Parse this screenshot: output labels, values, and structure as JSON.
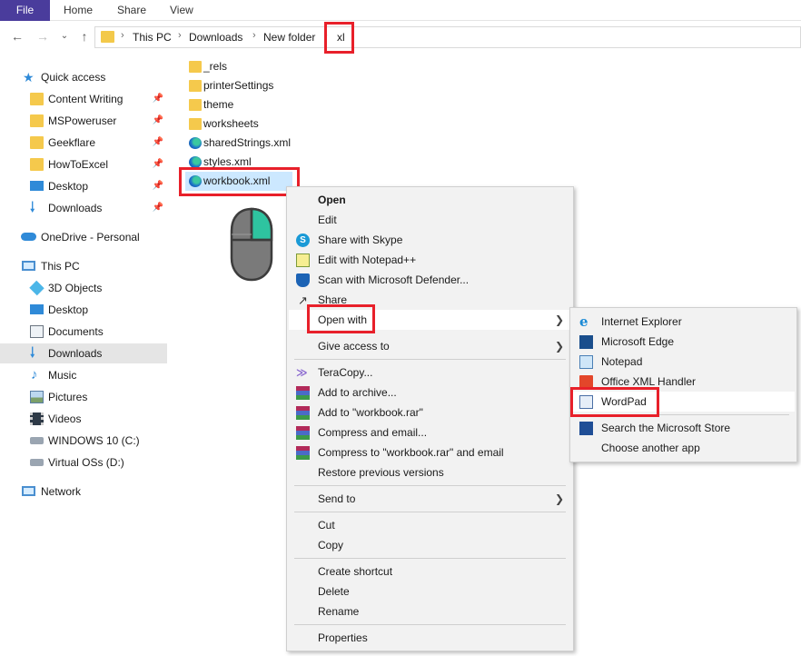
{
  "ribbon": {
    "tabs": [
      "File",
      "Home",
      "Share",
      "View"
    ]
  },
  "navbar": {
    "breadcrumb": [
      "This PC",
      "Downloads",
      "New folder",
      "xl"
    ]
  },
  "sidebar": {
    "quick_access": "Quick access",
    "pinned": [
      "Content Writing",
      "MSPoweruser",
      "Geekflare",
      "HowToExcel",
      "Desktop",
      "Downloads"
    ],
    "onedrive": "OneDrive - Personal",
    "this_pc": "This PC",
    "pc_items": [
      "3D Objects",
      "Desktop",
      "Documents",
      "Downloads",
      "Music",
      "Pictures",
      "Videos",
      "WINDOWS 10 (C:)",
      "Virtual OSs (D:)"
    ],
    "network": "Network",
    "selected": "Downloads"
  },
  "files": [
    {
      "name": "_rels",
      "type": "folder"
    },
    {
      "name": "printerSettings",
      "type": "folder"
    },
    {
      "name": "theme",
      "type": "folder"
    },
    {
      "name": "worksheets",
      "type": "folder"
    },
    {
      "name": "sharedStrings.xml",
      "type": "xml"
    },
    {
      "name": "styles.xml",
      "type": "xml"
    },
    {
      "name": "workbook.xml",
      "type": "xml"
    }
  ],
  "context_menu": {
    "items": [
      {
        "label": "Open",
        "icon": "none"
      },
      {
        "label": "Edit",
        "icon": "none"
      },
      {
        "label": "Share with Skype",
        "icon": "skype-icon"
      },
      {
        "label": "Edit with Notepad++",
        "icon": "notepad-plus-plus-icon"
      },
      {
        "label": "Scan with Microsoft Defender...",
        "icon": "defender-icon"
      },
      {
        "label": "Share",
        "icon": "share-icon"
      },
      {
        "label": "Open with",
        "icon": "none"
      },
      {
        "label": "Give access to",
        "icon": "none"
      },
      {
        "label": "TeraCopy...",
        "icon": "teracopy-icon"
      },
      {
        "label": "Add to archive...",
        "icon": "winrar-icon"
      },
      {
        "label": "Add to \"workbook.rar\"",
        "icon": "winrar-icon"
      },
      {
        "label": "Compress and email...",
        "icon": "winrar-icon"
      },
      {
        "label": "Compress to \"workbook.rar\" and email",
        "icon": "winrar-icon"
      },
      {
        "label": "Restore previous versions",
        "icon": "none"
      },
      {
        "label": "Send to",
        "icon": "none"
      },
      {
        "label": "Cut",
        "icon": "none"
      },
      {
        "label": "Copy",
        "icon": "none"
      },
      {
        "label": "Create shortcut",
        "icon": "none"
      },
      {
        "label": "Delete",
        "icon": "none"
      },
      {
        "label": "Rename",
        "icon": "none"
      },
      {
        "label": "Properties",
        "icon": "none"
      }
    ]
  },
  "open_with_menu": {
    "items": [
      {
        "label": "Internet Explorer",
        "icon": "internet-explorer-icon"
      },
      {
        "label": "Microsoft Edge",
        "icon": "edge-icon"
      },
      {
        "label": "Notepad",
        "icon": "notepad-icon"
      },
      {
        "label": "Office XML Handler",
        "icon": "office-icon"
      },
      {
        "label": "WordPad",
        "icon": "wordpad-icon"
      },
      {
        "label": "Search the Microsoft Store",
        "icon": "store-icon"
      },
      {
        "label": "Choose another app",
        "icon": "none"
      }
    ]
  },
  "colors": {
    "file_tab": "#4a3c9c",
    "highlight": "#e8202a",
    "folder": "#f5c94c",
    "selection": "#cce8ff",
    "mouse_button": "#2ec4a0"
  }
}
